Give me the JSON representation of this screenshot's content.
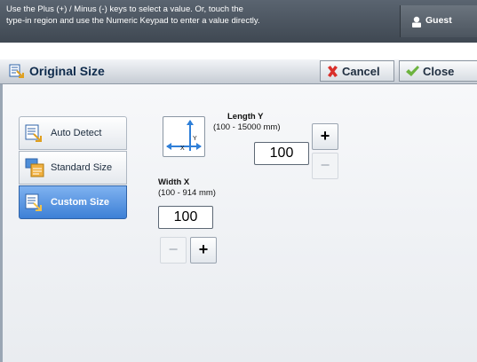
{
  "message": {
    "line1": "Use the Plus (+) / Minus (-) keys to select a value.  Or, touch the",
    "line2": "type-in region and use the Numeric Keypad to enter a value directly."
  },
  "user": {
    "label": "Guest",
    "icon": "user-icon"
  },
  "title": {
    "text": "Original Size",
    "icon": "original-size-icon"
  },
  "buttons": {
    "cancel": {
      "label": "Cancel",
      "icon": "x-icon",
      "color": "#d9302b"
    },
    "close": {
      "label": "Close",
      "icon": "checkmark-icon",
      "color": "#6db33f"
    }
  },
  "options": [
    {
      "label": "Auto Detect",
      "icon": "auto-detect-icon",
      "selected": false
    },
    {
      "label": "Standard Size",
      "icon": "standard-size-icon",
      "selected": false
    },
    {
      "label": "Custom Size",
      "icon": "custom-size-icon",
      "selected": true
    }
  ],
  "length_y": {
    "label": "Length Y",
    "range": "(100 - 15000 mm)",
    "value": "100",
    "plus": "+",
    "minus": "−"
  },
  "width_x": {
    "label": "Width X",
    "range": "(100 - 914 mm)",
    "value": "100",
    "plus": "+",
    "minus": "−"
  },
  "diagram": {
    "x_label": "X",
    "y_label": "Y"
  },
  "colors": {
    "accent": "#3d80d6",
    "title_text": "#0f2b4c"
  }
}
